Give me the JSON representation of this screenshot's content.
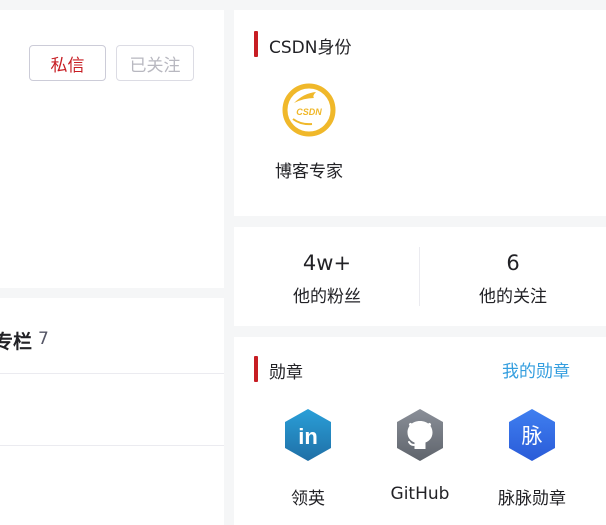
{
  "profile_actions": {
    "message_label": "私信",
    "followed_label": "已关注"
  },
  "columns": {
    "title": "专栏",
    "count": "7"
  },
  "identity": {
    "title": "CSDN身份",
    "badge_text": "CSDN",
    "badge_label": "博客专家"
  },
  "stats": {
    "fans_count": "4w+",
    "fans_label": "他的粉丝",
    "following_count": "6",
    "following_label": "他的关注"
  },
  "medals": {
    "title": "勋章",
    "my_medals_link": "我的勋章",
    "items": [
      {
        "label": "领英",
        "icon": "linkedin-icon",
        "glyph": "in"
      },
      {
        "label": "GitHub",
        "icon": "github-icon"
      },
      {
        "label": "脉脉勋章",
        "icon": "maimai-icon",
        "glyph": "脉"
      }
    ]
  },
  "colors": {
    "accent_red": "#c71d23",
    "link_blue": "#349edf",
    "gold": "#f0b82a"
  }
}
